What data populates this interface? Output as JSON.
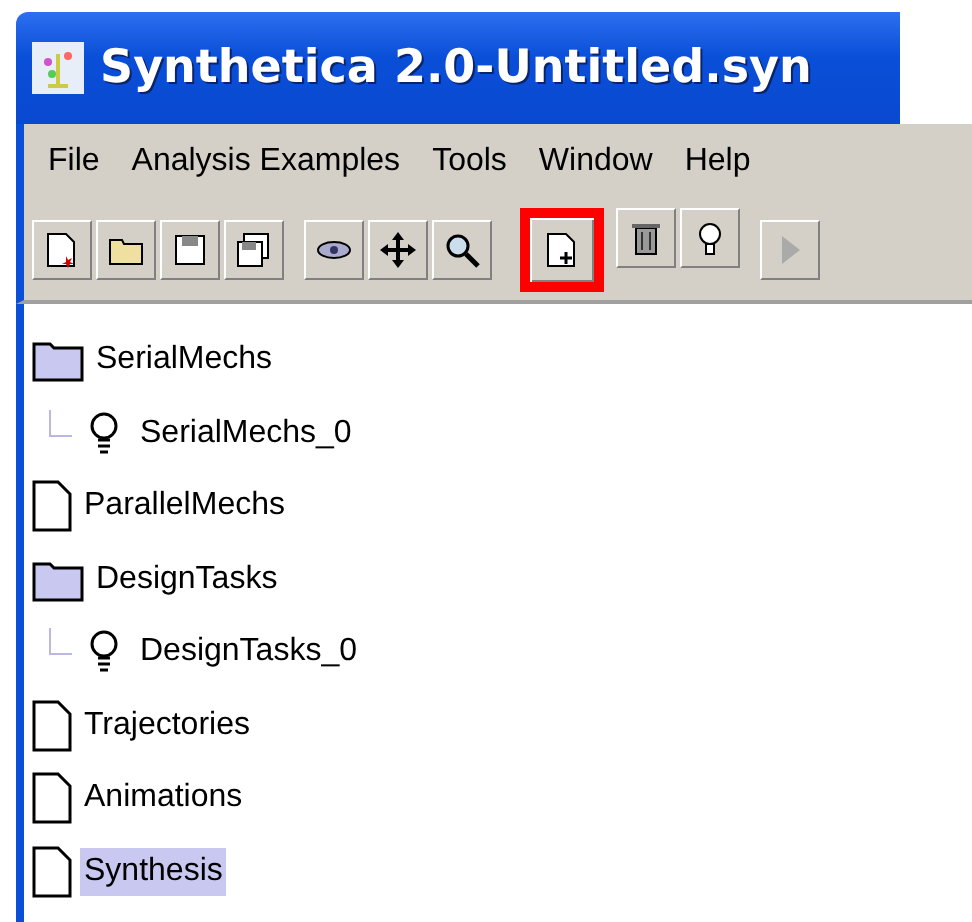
{
  "window": {
    "title": "Synthetica 2.0-Untitled.syn"
  },
  "menu": [
    {
      "label": "File"
    },
    {
      "label": "Analysis Examples"
    },
    {
      "label": "Tools"
    },
    {
      "label": "Window"
    },
    {
      "label": "Help"
    }
  ],
  "toolbar": [
    {
      "buttons": [
        {
          "kind": "new",
          "highlighted": false
        },
        {
          "kind": "open",
          "highlighted": false
        },
        {
          "kind": "save",
          "highlighted": false
        },
        {
          "kind": "saveall",
          "highlighted": false
        }
      ]
    },
    {
      "buttons": [
        {
          "kind": "link",
          "highlighted": false
        },
        {
          "kind": "move",
          "highlighted": false
        },
        {
          "kind": "zoom",
          "highlighted": false
        }
      ]
    },
    {
      "buttons": [
        {
          "kind": "add",
          "highlighted": true
        },
        {
          "kind": "delete",
          "highlighted": false
        },
        {
          "kind": "bulb",
          "highlighted": false
        }
      ]
    },
    {
      "buttons": [
        {
          "kind": "play",
          "highlighted": false
        }
      ]
    }
  ],
  "tree": [
    {
      "kind": "folder",
      "label": "SerialMechs",
      "selected": false,
      "children": [
        {
          "kind": "bulb",
          "label": "SerialMechs_0",
          "selected": false
        }
      ]
    },
    {
      "kind": "doc",
      "label": "ParallelMechs",
      "selected": false
    },
    {
      "kind": "folder",
      "label": "DesignTasks",
      "selected": false,
      "children": [
        {
          "kind": "bulb",
          "label": "DesignTasks_0",
          "selected": false
        }
      ]
    },
    {
      "kind": "doc",
      "label": "Trajectories",
      "selected": false
    },
    {
      "kind": "doc",
      "label": "Animations",
      "selected": false
    },
    {
      "kind": "doc",
      "label": "Synthesis",
      "selected": true
    }
  ]
}
